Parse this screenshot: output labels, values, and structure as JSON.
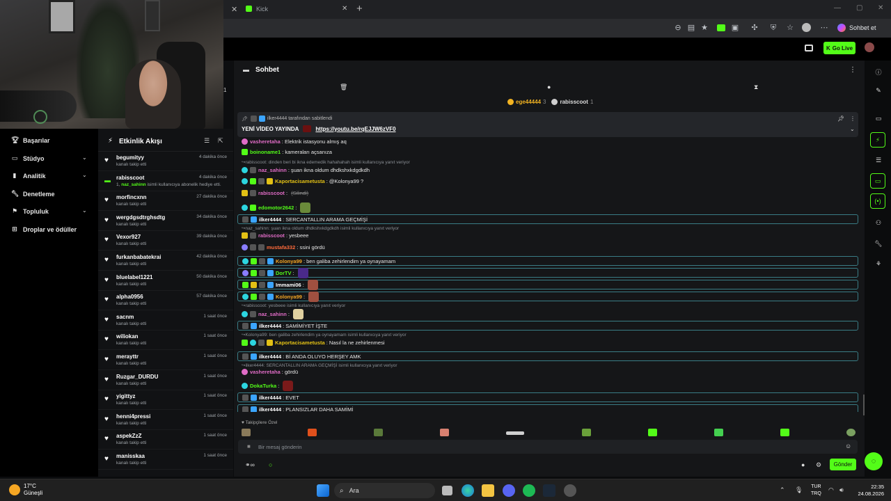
{
  "browser": {
    "tab_title": "Kick",
    "profile_label": "Sohbet et"
  },
  "kick_header": {
    "go_live": "Go Live"
  },
  "sidenav": {
    "items": [
      {
        "label": "Başarılar",
        "icon": "trophy-icon",
        "chevron": false
      },
      {
        "label": "Stüdyo",
        "icon": "studio-icon",
        "chevron": true
      },
      {
        "label": "Analitik",
        "icon": "analytics-icon",
        "chevron": true
      },
      {
        "label": "Denetleme",
        "icon": "wrench-icon",
        "chevron": false
      },
      {
        "label": "Topluluk",
        "icon": "community-icon",
        "chevron": true
      },
      {
        "label": "Droplar ve ödüller",
        "icon": "gift-icon",
        "chevron": false
      }
    ]
  },
  "feed": {
    "title": "Etkinlik Akışı",
    "rows": [
      {
        "name": "begumityy",
        "action": "kanalı takip etti",
        "time": "4 dakika önce"
      },
      {
        "name": "rabisscoot",
        "action_prefix": "1,",
        "action_user": "naz_sahinn",
        "action": "isimli kullanıcıya abonelik hediye etti.",
        "time": "4 dakika önce",
        "sub": true
      },
      {
        "name": "morfincxnn",
        "action": "kanalı takip etti",
        "time": "27 dakika önce"
      },
      {
        "name": "wergdgsdtrghsdtg",
        "action": "kanalı takip etti",
        "time": "34 dakika önce"
      },
      {
        "name": "Vexor927",
        "action": "kanalı takip etti",
        "time": "39 dakika önce"
      },
      {
        "name": "furkanbabatekrai",
        "action": "kanalı takip etti",
        "time": "42 dakika önce"
      },
      {
        "name": "bluelabel1221",
        "action": "kanalı takip etti",
        "time": "50 dakika önce"
      },
      {
        "name": "alpha0956",
        "action": "kanalı takip etti",
        "time": "57 dakika önce"
      },
      {
        "name": "sacnm",
        "action": "kanalı takip etti",
        "time": "1 saat önce"
      },
      {
        "name": "wiliokan",
        "action": "kanalı takip etti",
        "time": "1 saat önce"
      },
      {
        "name": "merayttr",
        "action": "kanalı takip etti",
        "time": "1 saat önce"
      },
      {
        "name": "Ruzgar_DURDU",
        "action": "kanalı takip etti",
        "time": "1 saat önce"
      },
      {
        "name": "yigittyz",
        "action": "kanalı takip etti",
        "time": "1 saat önce"
      },
      {
        "name": "henni4pressi",
        "action": "kanalı takip etti",
        "time": "1 saat önce"
      },
      {
        "name": "aspekZzZ",
        "action": "kanalı takip etti",
        "time": "1 saat önce"
      },
      {
        "name": "manisskaa",
        "action": "kanalı takip etti",
        "time": "1 saat önce"
      }
    ]
  },
  "chat": {
    "title": "Sohbet",
    "leaders": [
      {
        "name": "ege44444",
        "count": "3"
      },
      {
        "name": "rabisscoot",
        "count": "1"
      }
    ],
    "pinned": {
      "pinned_by": "ilker4444 tarafından sabitlendi",
      "text": "YENİ VİDEO YAYINDA",
      "link": "https://youtu.be/rqEJJW6zVF0"
    },
    "messages": [
      {
        "user": "vasheretaha",
        "color": "#e06cc6",
        "text": "Elektrik istasyonu almış aq"
      },
      {
        "user": "boinoname1",
        "color": "#53fc18",
        "text": "kameraları açsanıza"
      },
      {
        "reply": "rabisscoot: dinden beri bi ikna edemedik hahahahah isimli kullanıcıya yanıt veriyor"
      },
      {
        "user": "naz_sahinn",
        "color": "#e06cc6",
        "text": "şuan ikna oldum dhdkshxkdgdkdh"
      },
      {
        "user": "Kaportacisametusta",
        "color": "#e2c015",
        "text": "@Kolonya99 ?"
      },
      {
        "user": "rabisscoot",
        "color": "#e06cc6",
        "text": "",
        "deleted": "(Silindi)"
      },
      {
        "user": "edomotor2642",
        "color": "#53fc18",
        "text": ""
      },
      {
        "user": "ilker4444",
        "color": "#ffffff",
        "text": "SERCANTALLIN ARAMA GEÇMİŞİ"
      },
      {
        "reply": "naz_sahinn: şuan ikna oldum dhdkshxkdgdkdh isimli kullanıcıya yanıt veriyor"
      },
      {
        "user": "rabisscoot",
        "color": "#e06cc6",
        "text": "yesbeee"
      },
      {
        "user": "mustafa332",
        "color": "#ff6b3b",
        "text": "ssini gördü"
      },
      {
        "user": "Kolonya99",
        "color": "#f5a623",
        "text": "ben galiba zehirlendim ya oynayamam"
      },
      {
        "user": "DorTV",
        "color": "#53fc18",
        "text": ""
      },
      {
        "user": "Immami06",
        "color": "#ffffff",
        "text": ""
      },
      {
        "user": "Kolonya99",
        "color": "#f5a623",
        "text": ""
      },
      {
        "reply": "rabisscoot: yesbeee isimli kullanıcıya yanıt veriyor"
      },
      {
        "user": "naz_sahinn",
        "color": "#e06cc6",
        "text": ""
      },
      {
        "user": "ilker4444",
        "color": "#ffffff",
        "text": "SAMİMİYET İŞTE"
      },
      {
        "reply": "Kolonya99: ben galiba zehirlendim ya oynayamam isimli kullanıcıya yanıt veriyor"
      },
      {
        "user": "Kaportacisametusta",
        "color": "#e2c015",
        "text": "Nasıl la ne zehirlenmesi"
      },
      {
        "user": "ilker4444",
        "color": "#ffffff",
        "text": "Bİ ANDA OLUYO HERŞEY AMK"
      },
      {
        "reply": "ilker4444: SERCANTALLIN ARAMA GEÇMİŞİ isimli kullanıcıya yanıt veriyor"
      },
      {
        "user": "vasheretaha",
        "color": "#e06cc6",
        "text": "gördü"
      },
      {
        "user": "DokaTurka",
        "color": "#53fc18",
        "text": ""
      },
      {
        "user": "ilker4444",
        "color": "#ffffff",
        "text": "EVET"
      },
      {
        "user": "ilker4444",
        "color": "#ffffff",
        "text": "PLANSIZLAR DAHA SAMİMİ"
      }
    ],
    "emotes_label": "Takipçilere Özel",
    "input_placeholder": "Bir mesaj gönderin",
    "send_label": "Gönder"
  },
  "taskbar": {
    "temp": "17°C",
    "weather": "Güneşli",
    "search": "Ara",
    "lang1": "TUR",
    "lang2": "TRQ",
    "time": "22:35",
    "date": "24.08.2026"
  },
  "colors": {
    "accent": "#53fc18",
    "background": "#151618"
  }
}
